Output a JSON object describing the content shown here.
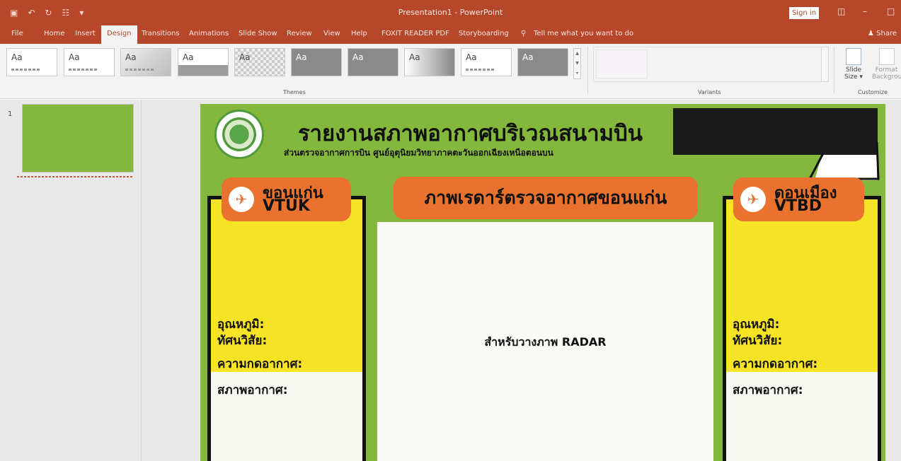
{
  "window": {
    "title": "Presentation1 - PowerPoint",
    "sign_in": "Sign in"
  },
  "tabs": [
    {
      "label": "File"
    },
    {
      "label": "Home"
    },
    {
      "label": "Insert"
    },
    {
      "label": "Design"
    },
    {
      "label": "Transitions"
    },
    {
      "label": "Animations"
    },
    {
      "label": "Slide Show"
    },
    {
      "label": "Review"
    },
    {
      "label": "View"
    },
    {
      "label": "Help"
    },
    {
      "label": "FOXIT READER PDF"
    },
    {
      "label": "Storyboarding"
    },
    {
      "label": "Tell me what you want to do"
    }
  ],
  "share_label": "Share",
  "ribbon": {
    "theme_sample": "Aa",
    "themes_label": "Themes",
    "variants_label": "Variants",
    "customize_label": "Customize",
    "slide_size": {
      "line1": "Slide",
      "line2": "Size"
    },
    "format_bg": {
      "line1": "Format",
      "line2": "Backgrou"
    }
  },
  "thumbnails": {
    "slide_number": "1"
  },
  "slide": {
    "headline": "รายงานสภาพอากาศบริเวณสนามบิน",
    "subhead": "ส่วนตรวจอากาศการบิน ศูนย์อุตุนิยมวิทยาภาคตะวันออกเฉียงเหนือตอนบน",
    "left_panel": {
      "city": "ขอนแก่น",
      "code": "VTUK",
      "temp_label": "อุณหภูมิ:",
      "visibility_label": "ทัศนวิสัย:",
      "pressure_label": "ความกดอากาศ:",
      "weather_label": "สภาพอากาศ:"
    },
    "right_panel": {
      "city": "ดอนเมือง",
      "code": "VTBD",
      "temp_label": "อุณหภูมิ:",
      "visibility_label": "ทัศนวิสัย:",
      "pressure_label": "ความกดอากาศ:",
      "weather_label": "สภาพอากาศ:"
    },
    "radar_title": "ภาพเรดาร์ตรวจอากาศขอนแก่น",
    "radar_placeholder": "สำหรับวางภาพ RADAR"
  },
  "colors": {
    "accent": "#b7472a",
    "slide_bg": "#84b83d",
    "pill": "#e9722e",
    "panel_yellow": "#f6e325"
  }
}
